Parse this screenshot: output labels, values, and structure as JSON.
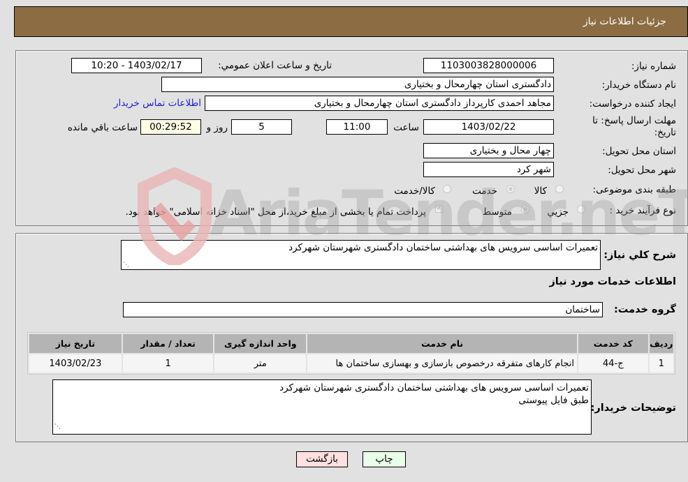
{
  "header": {
    "title": "جزئیات اطلاعات نیاز"
  },
  "info": {
    "need_number_label": "شماره نیاز:",
    "need_number": "1103003828000006",
    "announce_label": "تاریخ و ساعت اعلان عمومي:",
    "announce_value": "1403/02/17 - 10:20",
    "buyer_org_label": "نام دستگاه خریدار:",
    "buyer_org": "دادگستری استان چهارمحال و بختیاری",
    "creator_label": "ایجاد کننده درخواست:",
    "creator": "مجاهد احمدی کارپرداز دادگستری استان چهارمحال و بختیاری",
    "contact_link": "اطلاعات تماس خریدار",
    "deadline_label": "مهلت ارسال پاسخ: تا تاریخ:",
    "deadline_date": "1403/02/22",
    "time_label": "ساعت",
    "deadline_time": "11:00",
    "days_value": "5",
    "days_label": "روز و",
    "remaining_time": "00:29:52",
    "remaining_label": "ساعت باقي مانده",
    "province_label": "استان محل تحویل:",
    "province": "چهار محال و بختیاری",
    "city_label": "شهر محل تحویل:",
    "city": "شهر کرد",
    "category_label": "طبقه بندی موضوعی:",
    "category_options": [
      {
        "label": "کالا",
        "selected": false
      },
      {
        "label": "خدمت",
        "selected": true
      },
      {
        "label": "کالا/خدمت",
        "selected": false
      }
    ],
    "process_label": "نوع فرآیند خرید :",
    "process_options": [
      {
        "label": "جزيي",
        "selected": false
      },
      {
        "label": "متوسط",
        "selected": true
      }
    ],
    "treasury_note": "پرداخت تمام یا بخشی از مبلغ خرید،از محل \"اسناد خزانه اسلامی\" خواهد بود.",
    "treasury_checked": true
  },
  "services": {
    "summary_label": "شرح کلي نیاز:",
    "summary": "تعمیرات اساسی سرویس های بهداشتی ساختمان دادگستری شهرستان شهرکرد",
    "section_title": "اطلاعات خدمات مورد نیاز",
    "group_label": "گروه خدمت:",
    "group_value": "ساختمان",
    "table": {
      "headers": [
        "ردیف",
        "کد خدمت",
        "نام خدمت",
        "واحد اندازه گیری",
        "تعداد / مقدار",
        "تاریخ نیاز"
      ],
      "rows": [
        [
          "1",
          "ج-44",
          "انجام کارهای متفرقه درخصوص بازسازی و بهسازی ساختمان ها",
          "متر",
          "1",
          "1403/02/23"
        ]
      ]
    },
    "buyer_notes_label": "توضیحات خریدار:",
    "buyer_notes_line1": "تعمیرات اساسی سرویس های بهداشتی ساختمان دادگستری شهرستان شهرکرد",
    "buyer_notes_line2": "طبق فایل پیوستی"
  },
  "buttons": {
    "print": "چاپ",
    "back": "بازگشت"
  },
  "watermark": {
    "text": "AriaTender.neT"
  },
  "colors": {
    "header": "#8c6d43",
    "print_bg": "#eaffea",
    "back_bg": "#ffe0e0",
    "link": "#2020d0"
  }
}
